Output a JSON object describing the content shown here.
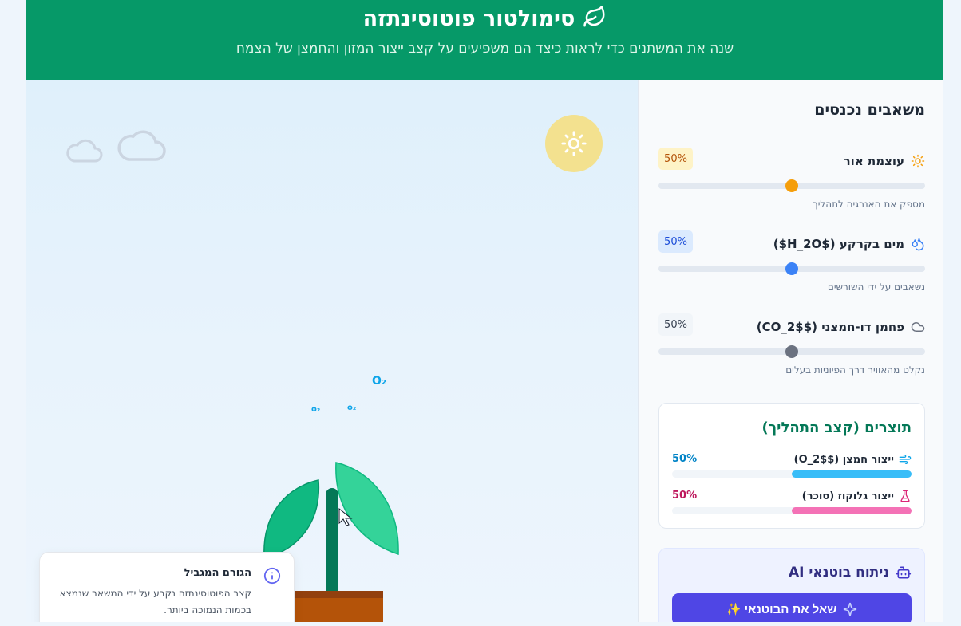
{
  "header": {
    "title": "סימולטור פוטוסינתזה",
    "subtitle": "שנה את המשתנים כדי לראות כיצד הם משפיעים על קצב ייצור המזון והחמצן של הצמח"
  },
  "inputs": {
    "title": "משאבים נכנסים",
    "light": {
      "label": "עוצמת אור",
      "value": "50%",
      "level": 0.5,
      "desc": "מספק את האנרגיה לתהליך",
      "icon": "sun-icon",
      "color": "#f59e0b"
    },
    "water": {
      "label": "מים בקרקע ($H_2O$)",
      "value": "50%",
      "level": 0.5,
      "desc": "נשאבים על ידי השורשים",
      "icon": "droplets-icon",
      "color": "#3b82f6"
    },
    "co2": {
      "label": "פחמן דו-חמצני ($CO_2$)",
      "value": "50%",
      "level": 0.5,
      "desc": "נקלט מהאוויר דרך הפיוניות בעלים",
      "icon": "cloud-icon",
      "color": "#6b7280"
    }
  },
  "products": {
    "title": "תוצרים (קצב התהליך)",
    "oxygen": {
      "label": "ייצור חמצן ($O_2$)",
      "value": "50%",
      "level": 0.5,
      "color": "#38bdf8",
      "text_color": "#0284c7",
      "icon": "wind-icon"
    },
    "glucose": {
      "label": "ייצור גלוקוז (סוכר)",
      "value": "50%",
      "level": 0.5,
      "color": "#f472b6",
      "text_color": "#be185d",
      "icon": "flask-icon"
    }
  },
  "ai": {
    "title": "ניתוח בוטנאי AI",
    "button_label": "שאל את הבוטנאי ✨",
    "icon": "bot-icon"
  },
  "limiting": {
    "title": "הגורם המגביל",
    "text": "קצב הפוטוסינתזה נקבע על ידי המשאב שנמצא בכמות הנמוכה ביותר."
  },
  "scene": {
    "o2_label": "O₂",
    "o2_small": "o₂"
  }
}
